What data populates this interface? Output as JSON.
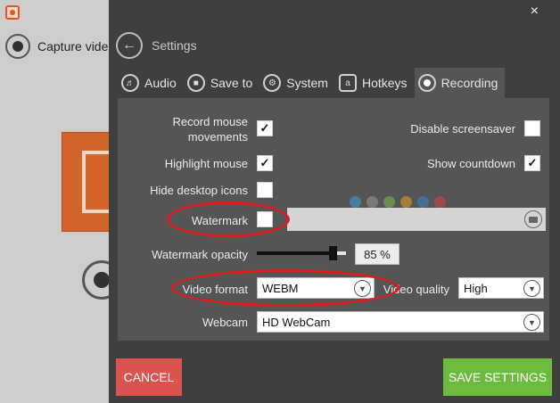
{
  "background_app": {
    "capture_label": "Capture video"
  },
  "settings": {
    "close_label": "×",
    "title": "Settings",
    "tabs": [
      {
        "label": "Audio",
        "icon": "speaker-icon"
      },
      {
        "label": "Save to",
        "icon": "folder-icon"
      },
      {
        "label": "System",
        "icon": "gear-icon"
      },
      {
        "label": "Hotkeys",
        "icon": "keyboard-icon"
      },
      {
        "label": "Recording",
        "icon": "record-icon",
        "active": true
      }
    ],
    "options": {
      "record_mouse": {
        "label": "Record mouse movements",
        "checked": true
      },
      "disable_screensaver": {
        "label": "Disable screensaver",
        "checked": false
      },
      "highlight_mouse": {
        "label": "Highlight mouse",
        "checked": true
      },
      "show_countdown": {
        "label": "Show countdown",
        "checked": true
      },
      "hide_desktop_icons": {
        "label": "Hide desktop icons",
        "checked": false
      },
      "watermark": {
        "label": "Watermark",
        "checked": false,
        "path": ""
      },
      "watermark_opacity": {
        "label": "Watermark opacity",
        "value": "85 %",
        "fraction": 0.85
      },
      "video_format": {
        "label": "Video format",
        "value": "WEBM"
      },
      "video_quality": {
        "label": "Video quality",
        "value": "High"
      },
      "webcam": {
        "label": "Webcam",
        "value": "HD WebCam"
      }
    },
    "check_mark": "✓",
    "cancel_label": "CANCEL",
    "save_label": "SAVE SETTINGS"
  },
  "colors": {
    "overlay_bg": "#3f3f3f",
    "panel_bg": "#555555",
    "cancel": "#d9534f",
    "save": "#6cbb3c",
    "highlight_ellipse": "#e01b1b",
    "brand_orange": "#d2652c"
  }
}
